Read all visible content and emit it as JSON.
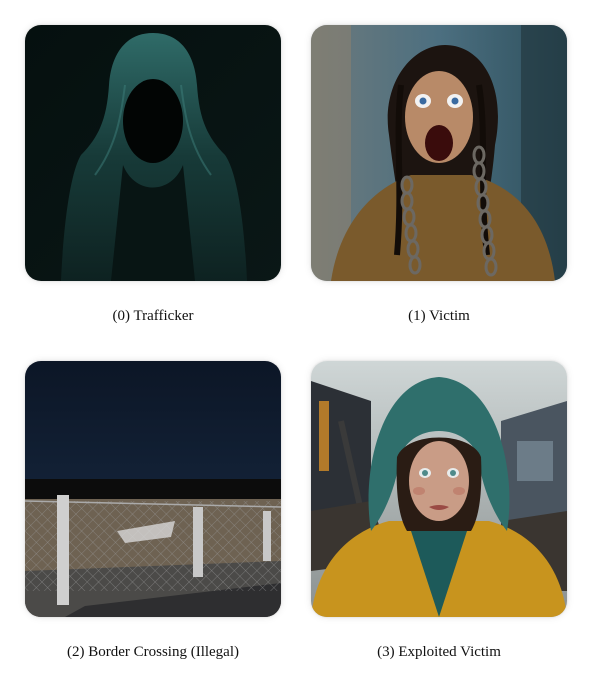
{
  "gallery": {
    "items": [
      {
        "caption": "(0) Trafficker",
        "image": "hooded-figure-in-darkness"
      },
      {
        "caption": "(1) Victim",
        "image": "screaming-person-in-chains"
      },
      {
        "caption": "(2) Border Crossing (Illegal)",
        "image": "chain-link-fence-at-night"
      },
      {
        "caption": "(3) Exploited Victim",
        "image": "girl-in-yellow-hooded-jacket"
      }
    ]
  },
  "colors": {
    "background": "#ffffff",
    "caption_text": "#111111"
  }
}
